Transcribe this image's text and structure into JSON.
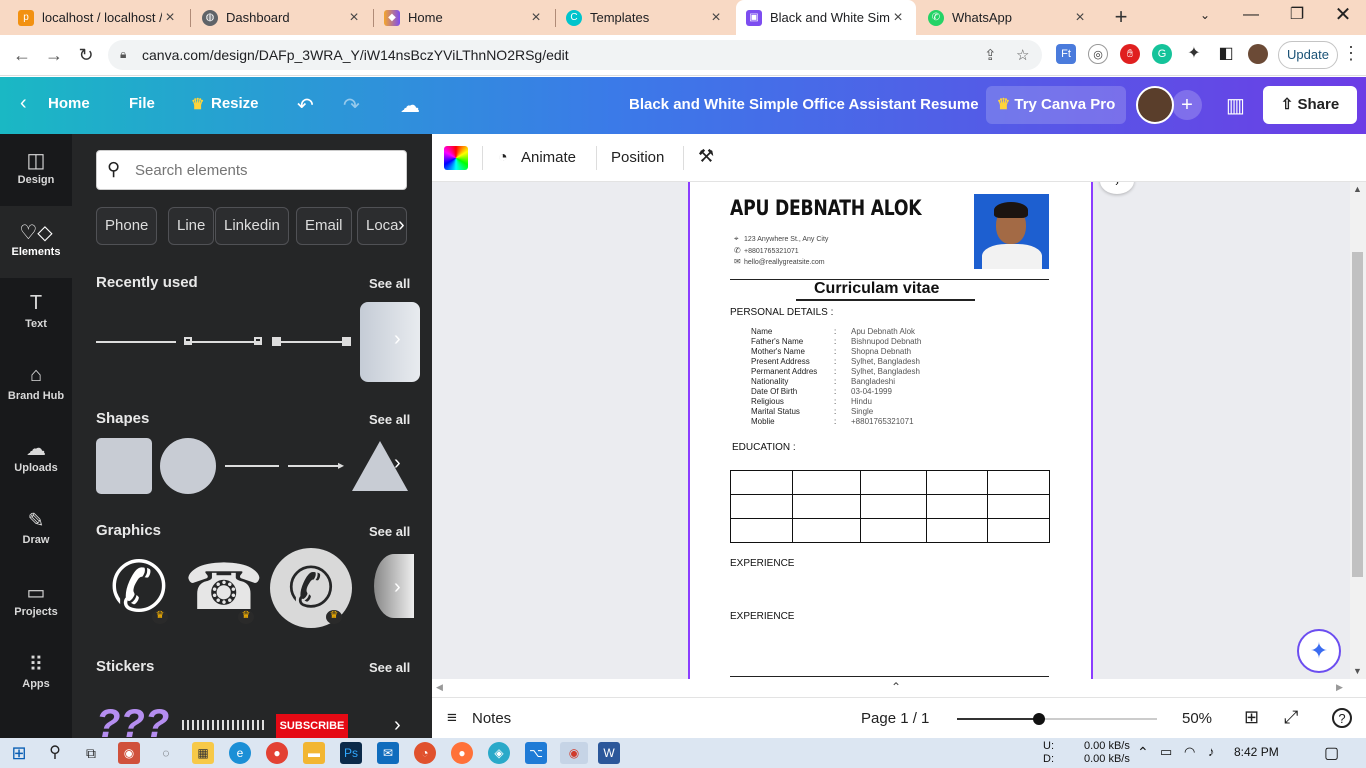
{
  "browser": {
    "tabs": [
      {
        "title": "localhost / localhost /",
        "favicon": "phpmyadmin-icon",
        "color": "#f29111"
      },
      {
        "title": "Dashboard",
        "favicon": "globe-icon",
        "color": "#5f6368"
      },
      {
        "title": "Home",
        "favicon": "bookmark-icon",
        "color": "#7d4df0"
      },
      {
        "title": "Templates",
        "favicon": "canva-icon",
        "color": "#00c4cc"
      },
      {
        "title": "Black and White Simp",
        "favicon": "canva-icon",
        "color": "#7d4df0",
        "active": true
      },
      {
        "title": "WhatsApp",
        "favicon": "whatsapp-icon",
        "color": "#25d366"
      }
    ],
    "url": "canva.com/design/DAFp_3WRA_Y/iW14nsBczYViLThnNO2RSg/edit",
    "update_label": "Update"
  },
  "canva": {
    "home_label": "Home",
    "file_label": "File",
    "resize_label": "Resize",
    "doc_title": "Black and White Simple Office Assistant Resume",
    "try_pro_label": "Try Canva Pro",
    "share_label": "Share",
    "rail": [
      {
        "label": "Design",
        "icon": "layout-icon"
      },
      {
        "label": "Elements",
        "icon": "shapes-icon",
        "active": true
      },
      {
        "label": "Text",
        "icon": "text-icon"
      },
      {
        "label": "Brand Hub",
        "icon": "brand-icon"
      },
      {
        "label": "Uploads",
        "icon": "cloud-upload-icon"
      },
      {
        "label": "Draw",
        "icon": "pen-icon"
      },
      {
        "label": "Projects",
        "icon": "folder-icon"
      },
      {
        "label": "Apps",
        "icon": "apps-grid-icon"
      }
    ],
    "panel": {
      "search_placeholder": "Search elements",
      "chips": [
        "Phone",
        "Line",
        "Linkedin",
        "Email",
        "Loca"
      ],
      "sections": {
        "recent": "Recently used",
        "shapes": "Shapes",
        "graphics": "Graphics",
        "stickers": "Stickers",
        "see_all": "See all"
      },
      "sticker_badge": "SUBSCRIBE"
    },
    "toolbar": {
      "animate_label": "Animate",
      "position_label": "Position"
    },
    "footer": {
      "notes_label": "Notes",
      "page_label": "Page 1 / 1",
      "zoom_label": "50%",
      "zoom_value": 0.5
    }
  },
  "resume": {
    "name": "APU DEBNATH ALOK",
    "address": "123 Anywhere St., Any City",
    "phone": "+8801765321071",
    "email": "hello@reallygreatsite.com",
    "heading": "Curriculam vitae",
    "personal_label": "PERSONAL DETAILS :",
    "personal": [
      {
        "key": "Name",
        "value": "Apu Debnath Alok"
      },
      {
        "key": "Father's Name",
        "value": "Bishnupod Debnath"
      },
      {
        "key": "Mother's Name",
        "value": "Shopna Debnath"
      },
      {
        "key": "Present Address",
        "value": "Sylhet, Bangladesh"
      },
      {
        "key": "Permanent Addres",
        "value": "Sylhet, Bangladesh"
      },
      {
        "key": "Nationality",
        "value": "Bangladeshi"
      },
      {
        "key": "Date Of Birth",
        "value": "03-04-1999"
      },
      {
        "key": "Religious",
        "value": "Hindu"
      },
      {
        "key": "Marital Status",
        "value": "Single"
      },
      {
        "key": "Moblie",
        "value": "+8801765321071"
      }
    ],
    "separator": ":",
    "education_label": "EDUCATION :",
    "experience_label_1": "EXPERIENCE",
    "experience_label_2": "EXPERIENCE"
  },
  "taskbar": {
    "net_up_label": "U:",
    "net_down_label": "D:",
    "net_up": "0.00 kB/s",
    "net_down": "0.00 kB/s",
    "time": "8:42 PM"
  }
}
